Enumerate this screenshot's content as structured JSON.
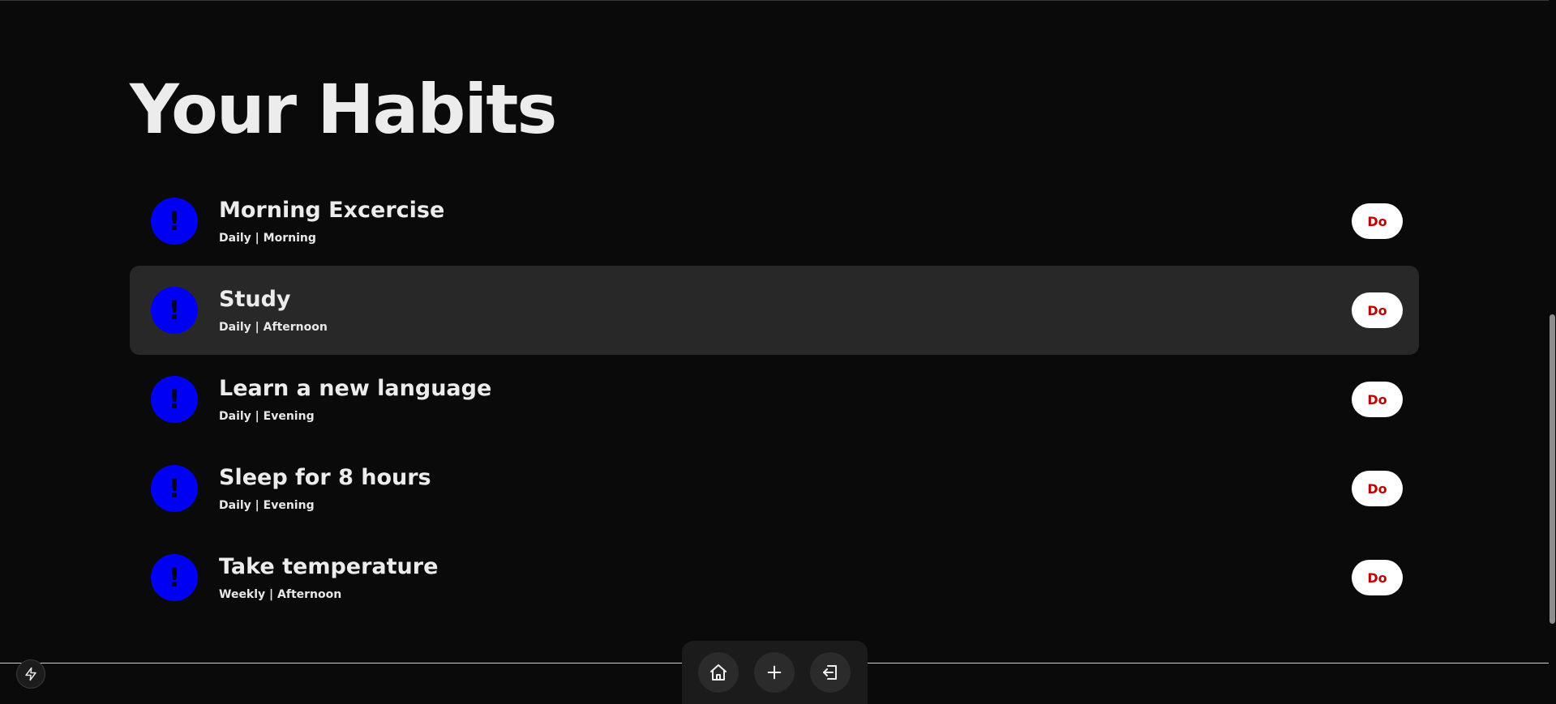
{
  "page": {
    "title": "Your Habits"
  },
  "habits": [
    {
      "name": "Morning Excercise",
      "meta": "Daily | Morning",
      "status_glyph": "!",
      "action": "Do"
    },
    {
      "name": "Study",
      "meta": "Daily | Afternoon",
      "status_glyph": "!",
      "action": "Do"
    },
    {
      "name": "Learn a new language",
      "meta": "Daily | Evening",
      "status_glyph": "!",
      "action": "Do"
    },
    {
      "name": "Sleep for 8 hours",
      "meta": "Daily | Evening",
      "status_glyph": "!",
      "action": "Do"
    },
    {
      "name": "Take temperature",
      "meta": "Weekly | Afternoon",
      "status_glyph": "!",
      "action": "Do"
    }
  ],
  "dock": {
    "icons": [
      "home-icon",
      "plus-icon",
      "logout-icon"
    ]
  },
  "floating": {
    "icon": "lightning-bolt-icon"
  },
  "colors": {
    "background": "#0a0a0a",
    "status_circle": "#0000f2",
    "do_text": "#c00000",
    "do_button": "#ffffff",
    "highlight_row": "#282828"
  }
}
